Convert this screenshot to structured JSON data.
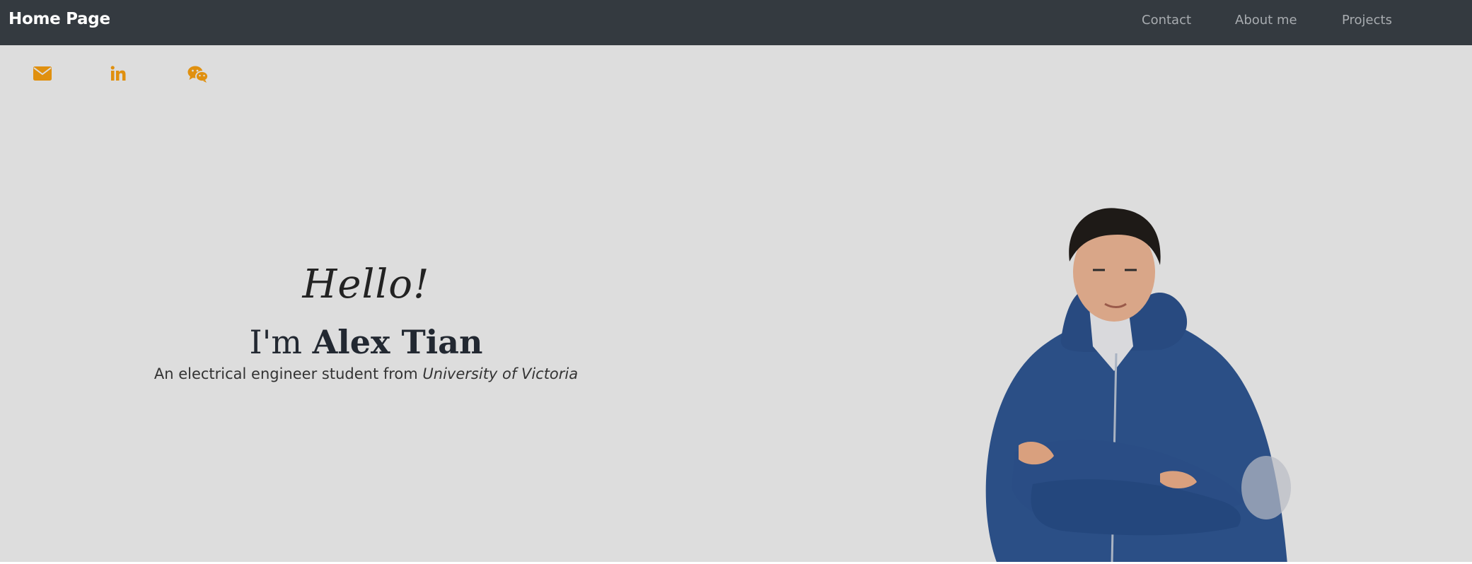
{
  "navbar": {
    "brand": "Home Page",
    "links": [
      {
        "label": "Contact"
      },
      {
        "label": "About me"
      },
      {
        "label": "Projects"
      }
    ]
  },
  "social": [
    {
      "icon": "envelope-icon",
      "color": "#e0900f"
    },
    {
      "icon": "linkedin-icon",
      "color": "#e0900f"
    },
    {
      "icon": "wechat-icon",
      "color": "#e0900f"
    }
  ],
  "hero": {
    "greeting": "Hello!",
    "intro_prefix": "I'm",
    "name": "Alex Tian",
    "subtitle_prefix": "An electrical engineer student from",
    "university": "University of Victoria"
  },
  "colors": {
    "navbar_bg": "#343a40",
    "page_bg": "#dddddd",
    "accent": "#e0900f",
    "jacket": "#2b4f86"
  }
}
